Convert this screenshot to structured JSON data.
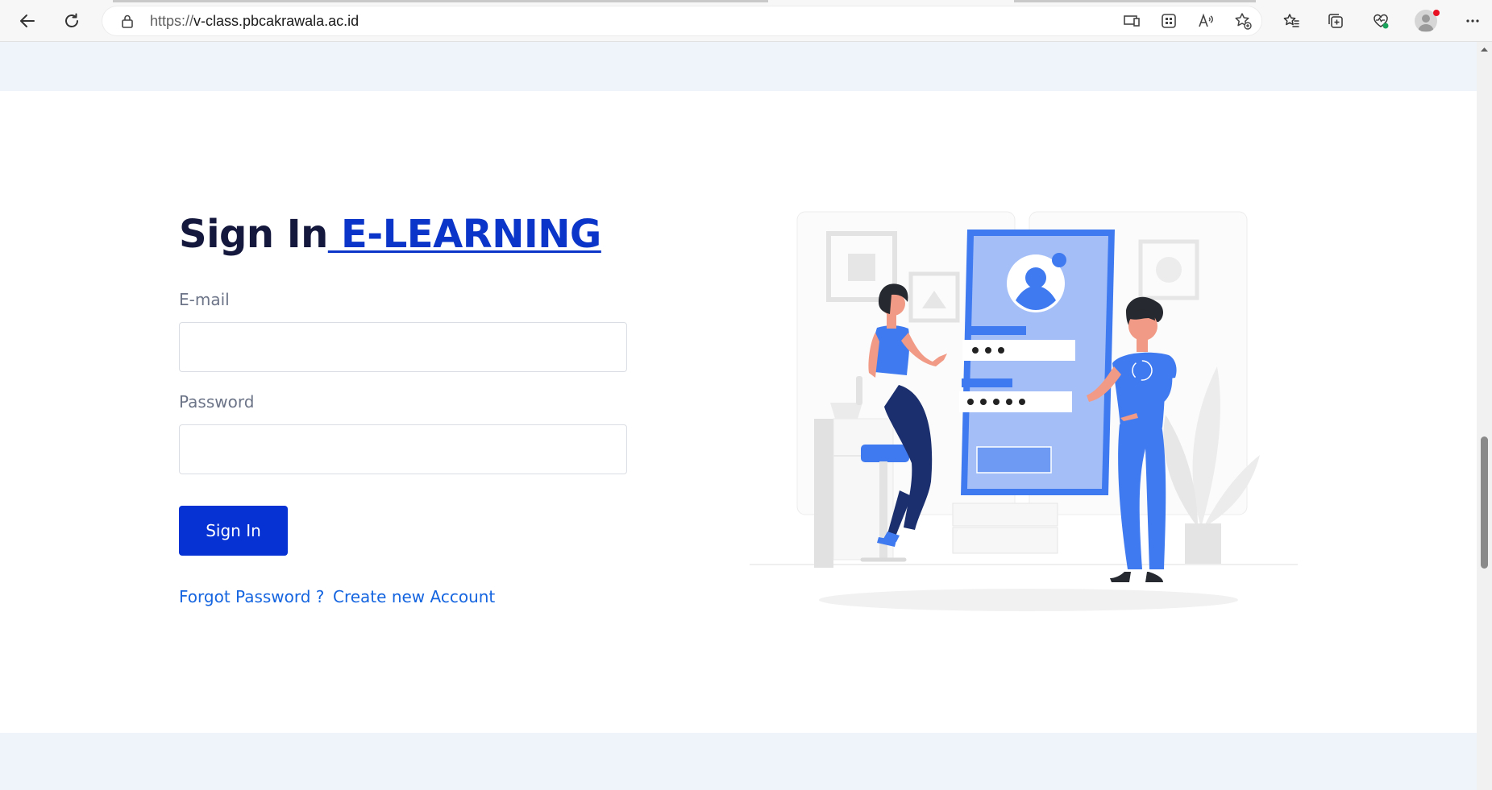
{
  "browser": {
    "url_scheme": "https://",
    "url_host": "v-class.pbcakrawala.ac.id"
  },
  "page": {
    "title_prefix": "Sign In",
    "title_link": " E-LEARNING",
    "email_label": "E-mail",
    "email_value": "",
    "password_label": "Password",
    "password_value": "",
    "signin_button": "Sign In",
    "forgot_link": "Forgot Password ?",
    "create_link": "Create new Account"
  },
  "colors": {
    "primary": "#0632d3",
    "link": "#1565e0",
    "heading": "#15183d",
    "band": "#eff4fb"
  },
  "icons": [
    "back-icon",
    "refresh-icon",
    "lock-icon",
    "device-icon",
    "apps-icon",
    "read-aloud-icon",
    "add-favorite-icon",
    "favorites-icon",
    "collections-icon",
    "health-icon",
    "profile-icon",
    "more-icon"
  ]
}
